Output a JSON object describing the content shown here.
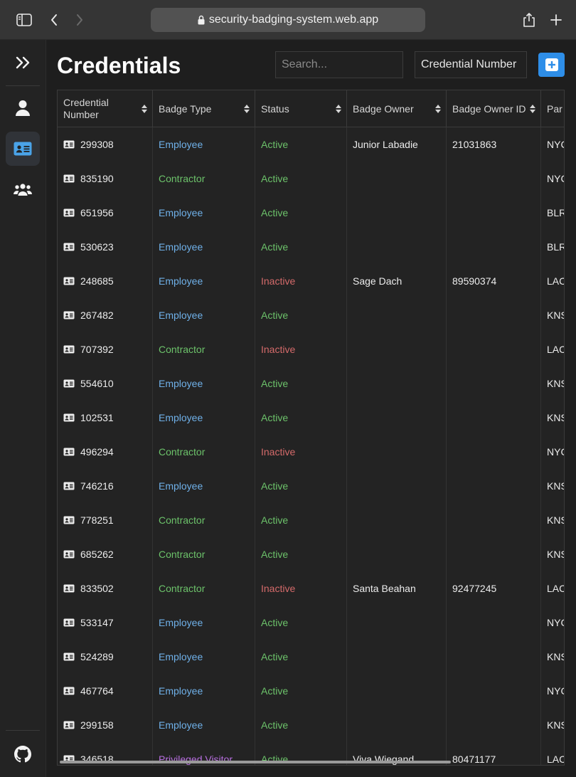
{
  "browser": {
    "url": "security-badging-system.web.app"
  },
  "page": {
    "title": "Credentials"
  },
  "search": {
    "placeholder": "Search..."
  },
  "filter": {
    "selected": "Credential Number"
  },
  "table": {
    "columns": [
      "Credential Number",
      "Badge Type",
      "Status",
      "Badge Owner",
      "Badge Owner ID",
      "Par"
    ],
    "rows": [
      {
        "credential": "299308",
        "type": "Employee",
        "status": "Active",
        "owner": "Junior Labadie",
        "owner_id": "21031863",
        "par": "NYC"
      },
      {
        "credential": "835190",
        "type": "Contractor",
        "status": "Active",
        "owner": "",
        "owner_id": "",
        "par": "NYC"
      },
      {
        "credential": "651956",
        "type": "Employee",
        "status": "Active",
        "owner": "",
        "owner_id": "",
        "par": "BLR"
      },
      {
        "credential": "530623",
        "type": "Employee",
        "status": "Active",
        "owner": "",
        "owner_id": "",
        "par": "BLR"
      },
      {
        "credential": "248685",
        "type": "Employee",
        "status": "Inactive",
        "owner": "Sage Dach",
        "owner_id": "89590374",
        "par": "LAC"
      },
      {
        "credential": "267482",
        "type": "Employee",
        "status": "Active",
        "owner": "",
        "owner_id": "",
        "par": "KNS"
      },
      {
        "credential": "707392",
        "type": "Contractor",
        "status": "Inactive",
        "owner": "",
        "owner_id": "",
        "par": "LAC"
      },
      {
        "credential": "554610",
        "type": "Employee",
        "status": "Active",
        "owner": "",
        "owner_id": "",
        "par": "KNS"
      },
      {
        "credential": "102531",
        "type": "Employee",
        "status": "Active",
        "owner": "",
        "owner_id": "",
        "par": "KNS"
      },
      {
        "credential": "496294",
        "type": "Contractor",
        "status": "Inactive",
        "owner": "",
        "owner_id": "",
        "par": "NYC"
      },
      {
        "credential": "746216",
        "type": "Employee",
        "status": "Active",
        "owner": "",
        "owner_id": "",
        "par": "KNS"
      },
      {
        "credential": "778251",
        "type": "Contractor",
        "status": "Active",
        "owner": "",
        "owner_id": "",
        "par": "KNS"
      },
      {
        "credential": "685262",
        "type": "Contractor",
        "status": "Active",
        "owner": "",
        "owner_id": "",
        "par": "KNS"
      },
      {
        "credential": "833502",
        "type": "Contractor",
        "status": "Inactive",
        "owner": "Santa Beahan",
        "owner_id": "92477245",
        "par": "LAC"
      },
      {
        "credential": "533147",
        "type": "Employee",
        "status": "Active",
        "owner": "",
        "owner_id": "",
        "par": "NYC"
      },
      {
        "credential": "524289",
        "type": "Employee",
        "status": "Active",
        "owner": "",
        "owner_id": "",
        "par": "KNS"
      },
      {
        "credential": "467764",
        "type": "Employee",
        "status": "Active",
        "owner": "",
        "owner_id": "",
        "par": "NYC"
      },
      {
        "credential": "299158",
        "type": "Employee",
        "status": "Active",
        "owner": "",
        "owner_id": "",
        "par": "KNS"
      },
      {
        "credential": "346518",
        "type": "Privileged Visitor",
        "status": "Active",
        "owner": "Viva Wiegand",
        "owner_id": "80471177",
        "par": "LAC"
      }
    ]
  },
  "colors": {
    "accent": "#2e8ee8",
    "employee": "#6fb0e8",
    "contractor": "#6cc26a",
    "privileged": "#b870e0",
    "active": "#6cc26a",
    "inactive": "#d46a6a"
  }
}
